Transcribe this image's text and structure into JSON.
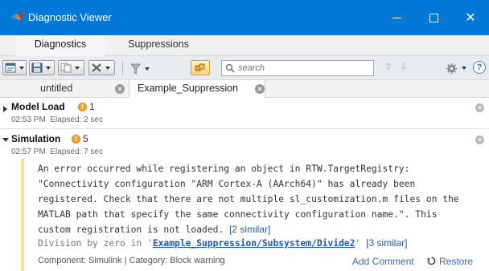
{
  "window": {
    "title": "Diagnostic Viewer",
    "close_glyph": "✕"
  },
  "main_tabs": [
    {
      "label": "Diagnostics",
      "active": true
    },
    {
      "label": "Suppressions",
      "active": false
    }
  ],
  "toolbar": {
    "search_placeholder": "search",
    "buttons": [
      "report-icon",
      "save-icon",
      "copy-icon",
      "clear-icon",
      "filter-icon",
      "highlight-icon",
      "settings-icon",
      "help-icon"
    ],
    "up_arrow": "⇧",
    "down_arrow": "⇩",
    "help_label": "?"
  },
  "model_tabs": [
    {
      "label": "untitled",
      "active": false
    },
    {
      "label": "Example_Suppression",
      "active": true
    }
  ],
  "sections": [
    {
      "title": "Model Load",
      "warning_count": "1",
      "time": "02:53 PM",
      "elapsed": "Elapsed: 2 sec",
      "expanded": false
    },
    {
      "title": "Simulation",
      "warning_count": "5",
      "time": "02:57 PM",
      "elapsed": "Elapsed: 7 sec",
      "expanded": true
    }
  ],
  "message": {
    "line1": "An error occurred while registering an object in RTW.TargetRegistry:",
    "line2": "\"Connectivity configuration \"ARM Cortex-A (AArch64)\" has already been",
    "line3": "registered. Check that there are not multiple sl_customization.m files on the",
    "line4": "MATLAB path that specify the same connectivity configuration name.\". This",
    "line5": "custom registration is not loaded.",
    "similar1": "[2 similar]",
    "div_prefix": "Division by zero in '",
    "div_link": "Example_Suppression/Subsystem/Divide2",
    "div_suffix": "'",
    "similar2": "[3 similar]",
    "footer": "Component: Simulink | Category: Block warning",
    "add_comment": "Add Comment",
    "restore": "Restore"
  },
  "colors": {
    "titlebar": "#0078d7",
    "warning": "#f5a623",
    "link": "#1b55c9",
    "action": "#3a6fb5"
  }
}
